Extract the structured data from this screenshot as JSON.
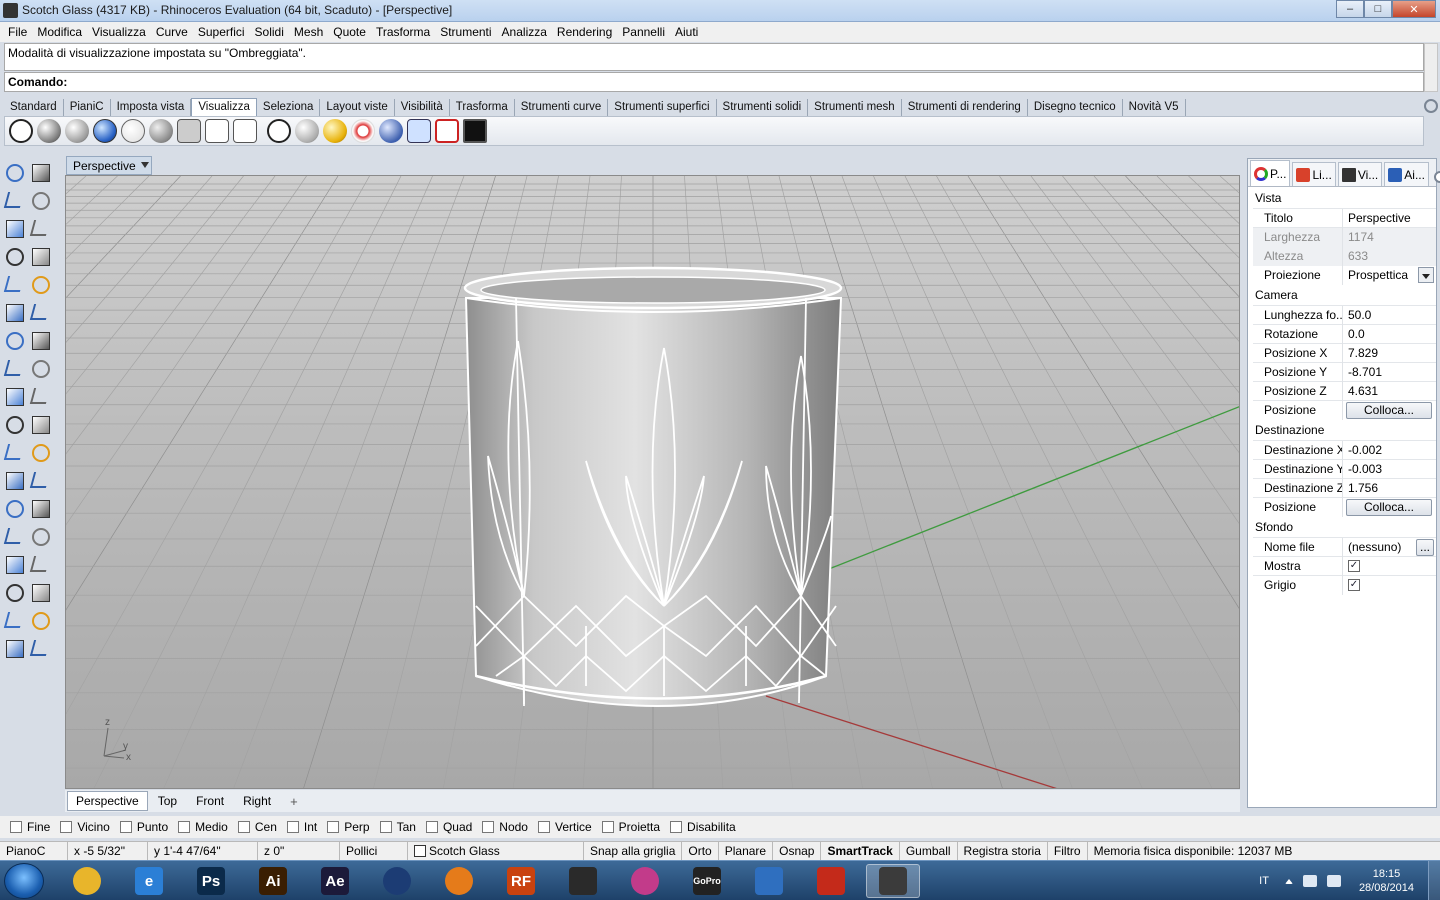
{
  "window": {
    "title": "Scotch Glass (4317 KB) - Rhinoceros Evaluation (64 bit, Scaduto) - [Perspective]",
    "min": "–",
    "max": "□",
    "close": "✕"
  },
  "menu": [
    "File",
    "Modifica",
    "Visualizza",
    "Curve",
    "Superfici",
    "Solidi",
    "Mesh",
    "Quote",
    "Trasforma",
    "Strumenti",
    "Analizza",
    "Rendering",
    "Pannelli",
    "Aiuti"
  ],
  "command": {
    "history": "Modalità di visualizzazione impostata su \"Ombreggiata\".",
    "prompt": "Comando:"
  },
  "toolbar_tabs": [
    "Standard",
    "PianiC",
    "Imposta vista",
    "Visualizza",
    "Seleziona",
    "Layout viste",
    "Visibilità",
    "Trasforma",
    "Strumenti curve",
    "Strumenti superfici",
    "Strumenti solidi",
    "Strumenti mesh",
    "Strumenti di rendering",
    "Disegno tecnico",
    "Novità V5"
  ],
  "toolbar_active": "Visualizza",
  "viewport": {
    "title": "Perspective",
    "axis_z": "z",
    "axis_y": "y",
    "axis_x": "x"
  },
  "view_tabs": [
    "Perspective",
    "Top",
    "Front",
    "Right"
  ],
  "view_tab_add": "+",
  "panel": {
    "tabs": [
      "P...",
      "Li...",
      "Vi...",
      "Ai..."
    ],
    "sections": {
      "vista": "Vista",
      "camera": "Camera",
      "destinazione": "Destinazione",
      "sfondo": "Sfondo"
    },
    "rows": {
      "titolo": {
        "k": "Titolo",
        "v": "Perspective"
      },
      "larghezza": {
        "k": "Larghezza",
        "v": "1174"
      },
      "altezza": {
        "k": "Altezza",
        "v": "633"
      },
      "proiezione": {
        "k": "Proiezione",
        "v": "Prospettica"
      },
      "lunghezza": {
        "k": "Lunghezza fo...",
        "v": "50.0"
      },
      "rotazione": {
        "k": "Rotazione",
        "v": "0.0"
      },
      "posx": {
        "k": "Posizione X",
        "v": "7.829"
      },
      "posy": {
        "k": "Posizione Y",
        "v": "-8.701"
      },
      "posz": {
        "k": "Posizione Z",
        "v": "4.631"
      },
      "posizione1": {
        "k": "Posizione",
        "v": "Colloca..."
      },
      "destx": {
        "k": "Destinazione X",
        "v": "-0.002"
      },
      "desty": {
        "k": "Destinazione Y",
        "v": "-0.003"
      },
      "destz": {
        "k": "Destinazione Z",
        "v": "1.756"
      },
      "posizione2": {
        "k": "Posizione",
        "v": "Colloca..."
      },
      "nomefile": {
        "k": "Nome file",
        "v": "(nessuno)",
        "btn": "..."
      },
      "mostra": {
        "k": "Mostra",
        "checked": true
      },
      "grigio": {
        "k": "Grigio",
        "checked": true
      }
    },
    "check_mark": "✓"
  },
  "osnap": [
    "Fine",
    "Vicino",
    "Punto",
    "Medio",
    "Cen",
    "Int",
    "Perp",
    "Tan",
    "Quad",
    "Nodo",
    "Vertice",
    "Proietta",
    "Disabilita"
  ],
  "status": {
    "cplane": "PianoC",
    "x": "x -5 5/32\"",
    "y": "y 1'-4 47/64\"",
    "z": "z 0\"",
    "units": "Pollici",
    "layer": "Scotch Glass",
    "snap": "Snap alla griglia",
    "orto": "Orto",
    "planare": "Planare",
    "osnap": "Osnap",
    "smarttrack": "SmartTrack",
    "gumball": "Gumball",
    "history": "Registra storia",
    "filtro": "Filtro",
    "memory": "Memoria fisica disponibile: 12037 MB"
  },
  "taskbar": {
    "apps": [
      {
        "name": "chrome",
        "label": "",
        "color": "#e8b52b"
      },
      {
        "name": "internet-explorer",
        "label": "e",
        "color": "#2b7fd6"
      },
      {
        "name": "photoshop",
        "label": "Ps",
        "color": "#0b2a4a"
      },
      {
        "name": "illustrator",
        "label": "Ai",
        "color": "#3a1e02"
      },
      {
        "name": "after-effects",
        "label": "Ae",
        "color": "#1c1a3a"
      },
      {
        "name": "cinema4d",
        "label": "",
        "color": "#1c3c74"
      },
      {
        "name": "blender",
        "label": "",
        "color": "#e57b1a"
      },
      {
        "name": "realflow",
        "label": "RF",
        "color": "#c9420f"
      },
      {
        "name": "unity",
        "label": "",
        "color": "#2a2a2a"
      },
      {
        "name": "picasa",
        "label": "",
        "color": "#c23b8a"
      },
      {
        "name": "gopro",
        "label": "GoPro",
        "color": "#222"
      },
      {
        "name": "keyshot",
        "label": "",
        "color": "#2f6fbf"
      },
      {
        "name": "sketchup",
        "label": "",
        "color": "#c42a1a"
      },
      {
        "name": "rhino",
        "label": "",
        "color": "#3b3b3b"
      }
    ],
    "lang": "IT",
    "time": "18:15",
    "date": "28/08/2014"
  },
  "colors": {
    "accent": "#3478c8",
    "x_axis": "#a53a3a",
    "y_axis": "#3f9b3f"
  }
}
